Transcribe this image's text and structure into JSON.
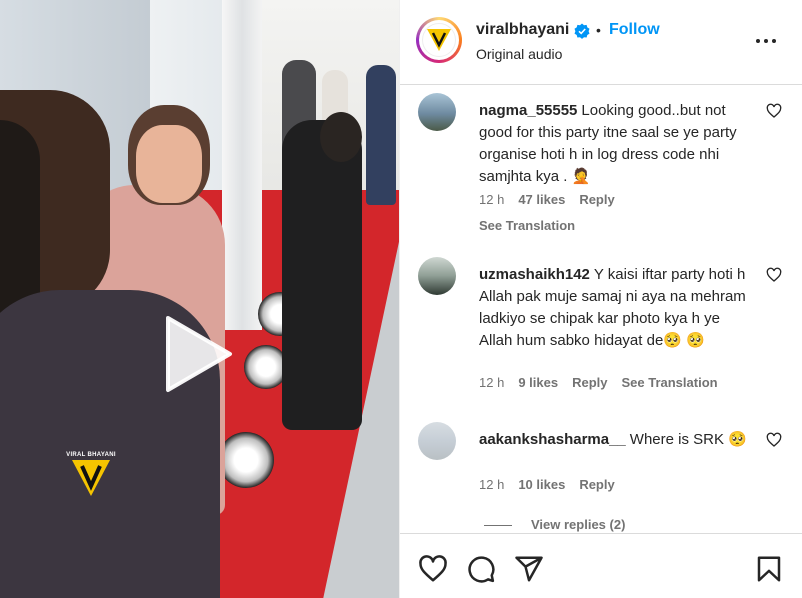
{
  "video": {
    "watermark_text": "VIRAL BHAYANI",
    "play_icon": "play-icon"
  },
  "header": {
    "username": "viralbhayani",
    "separator": "•",
    "follow_label": "Follow",
    "subtitle": "Original audio",
    "verified_icon": "verified-badge-icon",
    "more_icon": "more-options-icon"
  },
  "comments": [
    {
      "username": "nagma_55555",
      "text": "Looking good..but not good for this party itne saal se ye party organise hoti h in log dress code nhi samjhta kya . 🤦",
      "time": "12 h",
      "likes": "47 likes",
      "reply": "Reply",
      "see_translation": "See Translation"
    },
    {
      "username": "uzmashaikh142",
      "text": "Y kaisi iftar party hoti h Allah pak muje samaj ni aya na mehram ladkiyo se chipak kar photo kya h ye Allah hum sabko hidayat de🥺 🥺",
      "time": "12 h",
      "likes": "9 likes",
      "reply": "Reply",
      "see_translation": "See Translation"
    },
    {
      "username": "aakankshasharma__",
      "text": "Where is SRK 🥺",
      "time": "12 h",
      "likes": "10 likes",
      "reply": "Reply"
    }
  ],
  "view_replies": "View replies (2)",
  "actions": [
    "like-icon",
    "comment-icon",
    "share-icon",
    "save-icon"
  ],
  "colors": {
    "accent": "#0095f6",
    "text": "#262626",
    "muted": "#737373",
    "carpet": "#d3262b",
    "brand_yellow": "#f5c400"
  }
}
